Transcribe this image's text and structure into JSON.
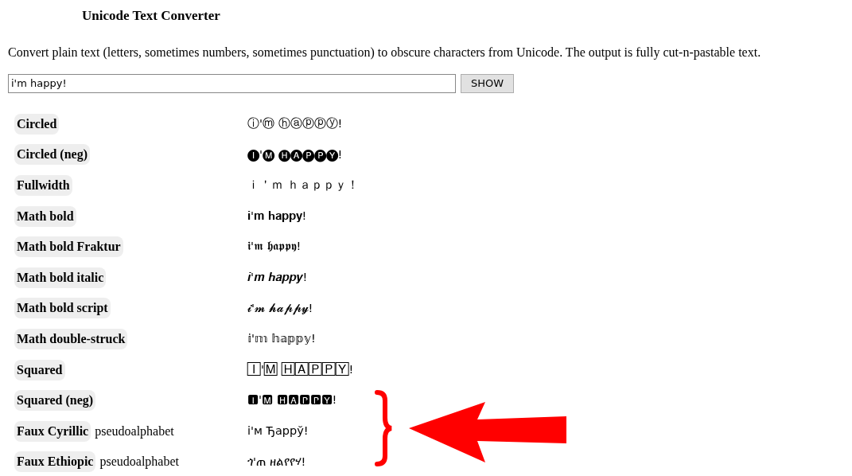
{
  "title": "Unicode Text Converter",
  "description": "Convert plain text (letters, sometimes numbers, sometimes punctuation) to obscure characters from Unicode. The output is fully cut-n-pastable text.",
  "input": {
    "value": "i'm happy!"
  },
  "button": "SHOW",
  "rows": [
    {
      "name": "Circled",
      "output": "ⓘ'ⓜ ⓗⓐⓟⓟⓨ!"
    },
    {
      "name": "Circled (neg)",
      "output": "🅘'🅜 🅗🅐🅟🅟🅨!"
    },
    {
      "name": "Fullwidth",
      "output": "ｉ＇ｍ ｈａｐｐｙ！"
    },
    {
      "name": "Math bold",
      "output": "𝐢'𝐦 𝐡𝐚𝐩𝐩𝐲!"
    },
    {
      "name": "Math bold Fraktur",
      "output": "𝖎'𝖒 𝖍𝖆𝖕𝖕𝖞!"
    },
    {
      "name": "Math bold italic",
      "output": "𝒊'𝒎 𝒉𝒂𝒑𝒑𝒚!"
    },
    {
      "name": "Math bold script",
      "output": "𝓲'𝓶 𝓱𝓪𝓹𝓹𝔂!"
    },
    {
      "name": "Math double-struck",
      "output": "𝕚'𝕞 𝕙𝕒𝕡𝕡𝕪!"
    },
    {
      "name": "Squared",
      "output": "🄸'🄼 🄷🄰🄿🄿🅈!"
    },
    {
      "name": "Squared (neg)",
      "output": "🅸'🅼 🅷🅰🅿🅿🆈!"
    },
    {
      "name": "Faux Cyrillic",
      "note": "pseudoalphabet",
      "output": "і'м Ђаррў!"
    },
    {
      "name": "Faux Ethiopic",
      "note": "pseudoalphabet",
      "output": "ጎ'ጠ ዘልየየሃ!"
    }
  ]
}
